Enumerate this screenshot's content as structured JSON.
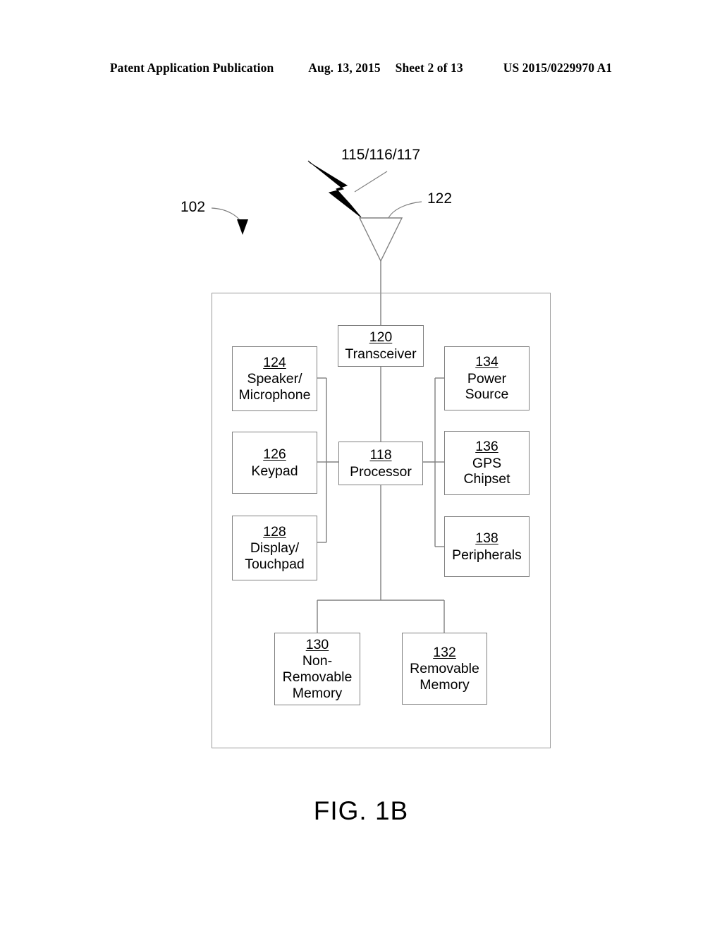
{
  "header": {
    "publication": "Patent Application Publication",
    "date": "Aug. 13, 2015",
    "sheet": "Sheet 2 of 13",
    "patent_number": "US 2015/0229970 A1"
  },
  "figure": {
    "caption": "FIG. 1B",
    "callouts": {
      "device": "102",
      "air_interface": "115/116/117",
      "antenna": "122"
    },
    "blocks": [
      {
        "id": "transceiver",
        "ref": "120",
        "label": "Transceiver"
      },
      {
        "id": "processor",
        "ref": "118",
        "label": "Processor"
      },
      {
        "id": "speaker-microphone",
        "ref": "124",
        "label": "Speaker/\nMicrophone"
      },
      {
        "id": "keypad",
        "ref": "126",
        "label": "Keypad"
      },
      {
        "id": "display-touchpad",
        "ref": "128",
        "label": "Display/\nTouchpad"
      },
      {
        "id": "power-source",
        "ref": "134",
        "label": "Power\nSource"
      },
      {
        "id": "gps-chipset",
        "ref": "136",
        "label": "GPS\nChipset"
      },
      {
        "id": "peripherals",
        "ref": "138",
        "label": "Peripherals"
      },
      {
        "id": "non-removable-memory",
        "ref": "130",
        "label": "Non-\nRemovable\nMemory"
      },
      {
        "id": "removable-memory",
        "ref": "132",
        "label": "Removable\nMemory"
      }
    ]
  },
  "colors": {
    "line": "#808080",
    "text": "#000000",
    "background": "#ffffff"
  }
}
